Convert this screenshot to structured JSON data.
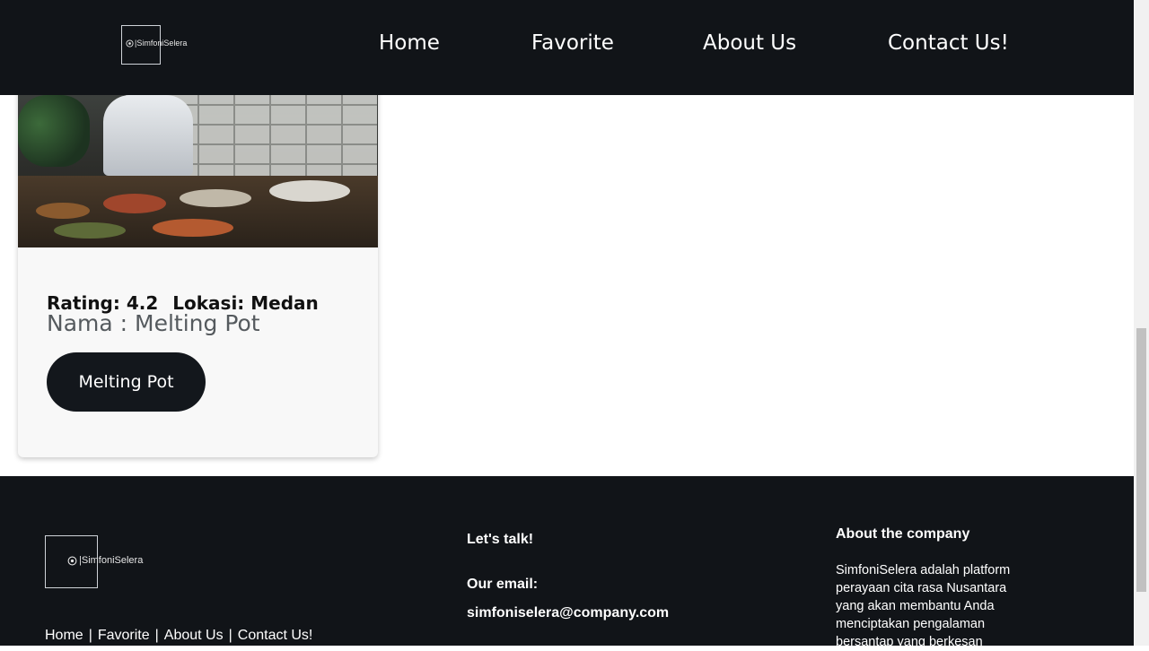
{
  "header": {
    "logo_text": "|SimfoniSelera",
    "nav": [
      {
        "label": "Home"
      },
      {
        "label": "Favorite"
      },
      {
        "label": "About Us"
      },
      {
        "label": "Contact Us!"
      }
    ]
  },
  "card": {
    "rating_label": "Rating: 4.2",
    "location_label": "Lokasi: Medan",
    "name_label": "Nama : Melting Pot",
    "button_label": "Melting Pot"
  },
  "footer": {
    "logo_text": "|SimfoniSelera",
    "links": [
      "Home",
      "Favorite",
      "About Us",
      "Contact Us!"
    ],
    "separator": "|",
    "talk_heading": "Let's talk!",
    "email_label": "Our email:",
    "email": "simfoniselera@company.com",
    "about_heading": "About the company",
    "about_text": "SimfoniSelera adalah platform perayaan cita rasa Nusantara yang akan membantu Anda menciptakan pengalaman bersantap yang berkesan"
  },
  "colors": {
    "dark": "#111418",
    "button": "#13171c",
    "name_text": "#555a5e"
  }
}
